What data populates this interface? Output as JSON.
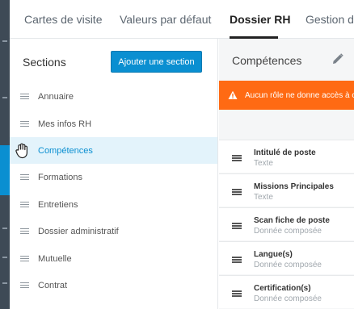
{
  "tabs": [
    {
      "label": "Cartes de visite"
    },
    {
      "label": "Valeurs par défaut"
    },
    {
      "label": "Dossier RH"
    },
    {
      "label": "Gestion de"
    }
  ],
  "left_panel": {
    "title": "Sections",
    "add_button": "Ajouter une section",
    "sections": [
      {
        "label": "Annuaire"
      },
      {
        "label": "Mes infos RH"
      },
      {
        "label": "Compétences"
      },
      {
        "label": "Formations"
      },
      {
        "label": "Entretiens"
      },
      {
        "label": "Dossier administratif"
      },
      {
        "label": "Mutuelle"
      },
      {
        "label": "Contrat"
      }
    ],
    "active_section": "Compétences"
  },
  "right_panel": {
    "title": "Compétences",
    "warning": "Aucun rôle ne donne accès à c",
    "fields": [
      {
        "name": "Intitulé de poste",
        "type": "Texte"
      },
      {
        "name": "Missions Principales",
        "type": "Texte"
      },
      {
        "name": "Scan fiche de poste",
        "type": "Donnée composée"
      },
      {
        "name": "Langue(s)",
        "type": "Donnée composée"
      },
      {
        "name": "Certification(s)",
        "type": "Donnée composée"
      }
    ]
  },
  "colors": {
    "accent": "#0a8fd1",
    "warning": "#ff6a13",
    "rail": "#3e4a56"
  }
}
